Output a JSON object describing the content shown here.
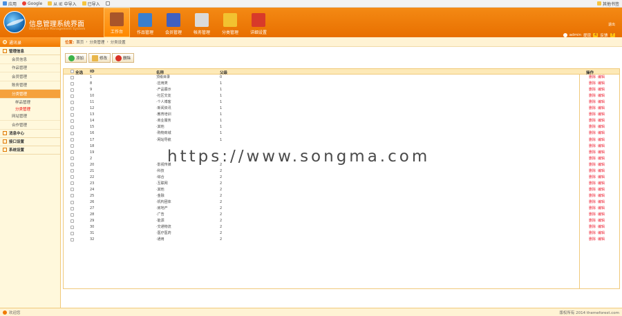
{
  "bookmarks": {
    "apps": "应用",
    "google": "Google",
    "ie_import": "从 IE 中导入",
    "imported": "已导入",
    "others": "其他书签"
  },
  "header": {
    "brand": "信息管理系统界面",
    "brand_sub": "Information Management System",
    "tabs": [
      {
        "label": "工作台",
        "color": "#a8552a"
      },
      {
        "label": "作品管理",
        "color": "#3a7fd0"
      },
      {
        "label": "会员管理",
        "color": "#4060c0"
      },
      {
        "label": "帐务管理",
        "color": "#dadada"
      },
      {
        "label": "分类管理",
        "color": "#f2c230"
      },
      {
        "label": "详细设置",
        "color": "#d83a2a"
      }
    ],
    "exit": "退出",
    "user": "admin",
    "msg_label": "提现",
    "msg_count": "4",
    "feedback_label": "反馈",
    "feedback_count": "7"
  },
  "sidebar": {
    "top": "通讯录",
    "manage": "管理信息",
    "items": [
      "会员信息",
      "作品管理",
      "会员管理",
      "账务管理",
      "分类管理"
    ],
    "subitems": [
      "样品管理",
      "分类管理"
    ],
    "items2": [
      "网站管理",
      "合作管理"
    ],
    "sections": [
      "消息中心",
      "接口设置",
      "系统设置"
    ]
  },
  "breadcrumb": {
    "label": "位置:",
    "home": "首页",
    "parent": "分类管理",
    "current": "分类设置",
    "sep": "›"
  },
  "toolbar": {
    "add": "添加",
    "edit": "修改",
    "delete": "删除"
  },
  "table": {
    "headers": {
      "select": "全选",
      "id": "ID",
      "name": "名称",
      "parent": "父级",
      "actions": "操作"
    },
    "action_delete": "删除",
    "action_edit": "编辑",
    "rows": [
      {
        "id": "1",
        "name": "顶级目录",
        "parent": "0"
      },
      {
        "id": "8",
        "name": "·应用类",
        "parent": "1"
      },
      {
        "id": "9",
        "name": "·产品展示",
        "parent": "1"
      },
      {
        "id": "10",
        "name": "·社区交友",
        "parent": "1"
      },
      {
        "id": "11",
        "name": "·个人博客",
        "parent": "1"
      },
      {
        "id": "12",
        "name": "·新闻资讯",
        "parent": "1"
      },
      {
        "id": "13",
        "name": "·教育培训",
        "parent": "1"
      },
      {
        "id": "14",
        "name": "·商业服务",
        "parent": "1"
      },
      {
        "id": "15",
        "name": "·其他",
        "parent": "1"
      },
      {
        "id": "16",
        "name": "·购物商城",
        "parent": "1"
      },
      {
        "id": "17",
        "name": "·网站导航",
        "parent": "1"
      },
      {
        "id": "18",
        "name": "",
        "parent": ""
      },
      {
        "id": "19",
        "name": "",
        "parent": ""
      },
      {
        "id": "2",
        "name": "",
        "parent": ""
      },
      {
        "id": "20",
        "name": "·影视传媒",
        "parent": "2"
      },
      {
        "id": "21",
        "name": "·科技",
        "parent": "2"
      },
      {
        "id": "22",
        "name": "·综合",
        "parent": "2"
      },
      {
        "id": "23",
        "name": "·互联网",
        "parent": "2"
      },
      {
        "id": "24",
        "name": "·其他",
        "parent": "2"
      },
      {
        "id": "25",
        "name": "·金融",
        "parent": "2"
      },
      {
        "id": "26",
        "name": "·机构团体",
        "parent": "2"
      },
      {
        "id": "27",
        "name": "·房地产",
        "parent": "2"
      },
      {
        "id": "28",
        "name": "·广告",
        "parent": "2"
      },
      {
        "id": "29",
        "name": "·能源",
        "parent": "2"
      },
      {
        "id": "30",
        "name": "·交通物流",
        "parent": "2"
      },
      {
        "id": "31",
        "name": "·医疗医药",
        "parent": "2"
      },
      {
        "id": "32",
        "name": "·通用",
        "parent": "2"
      }
    ]
  },
  "footer": {
    "left": "欢迎您",
    "right": "版权所有 2014 themeforest.com"
  },
  "watermark": "https://www.songma.com"
}
